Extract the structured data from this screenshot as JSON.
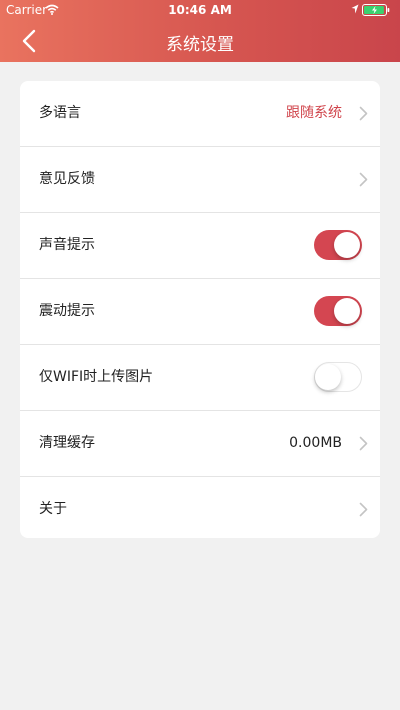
{
  "status_bar": {
    "carrier": "Carrier",
    "time": "10:46 AM",
    "battery_level": 0.95,
    "icons": [
      "wifi-icon",
      "location-arrow-icon",
      "battery-charging-icon"
    ]
  },
  "nav": {
    "title": "系统设置",
    "back_icon": "chevron-left-icon"
  },
  "theme": {
    "header_gradient": [
      "#e9735f",
      "#c9454b"
    ],
    "accent": "#d0444b",
    "toggle_on": "#d44651",
    "background": "#f1f1f1"
  },
  "settings": {
    "items": [
      {
        "label": "多语言",
        "value": "跟随系统",
        "control": "chevron"
      },
      {
        "label": "意见反馈",
        "value": "",
        "control": "chevron"
      },
      {
        "label": "声音提示",
        "control": "toggle",
        "on": true
      },
      {
        "label": "震动提示",
        "control": "toggle",
        "on": true
      },
      {
        "label": "仅WIFI时上传图片",
        "control": "toggle",
        "on": false
      },
      {
        "label": "清理缓存",
        "value": "0.00MB",
        "control": "chevron"
      },
      {
        "label": "关于",
        "value": "",
        "control": "chevron"
      }
    ]
  }
}
